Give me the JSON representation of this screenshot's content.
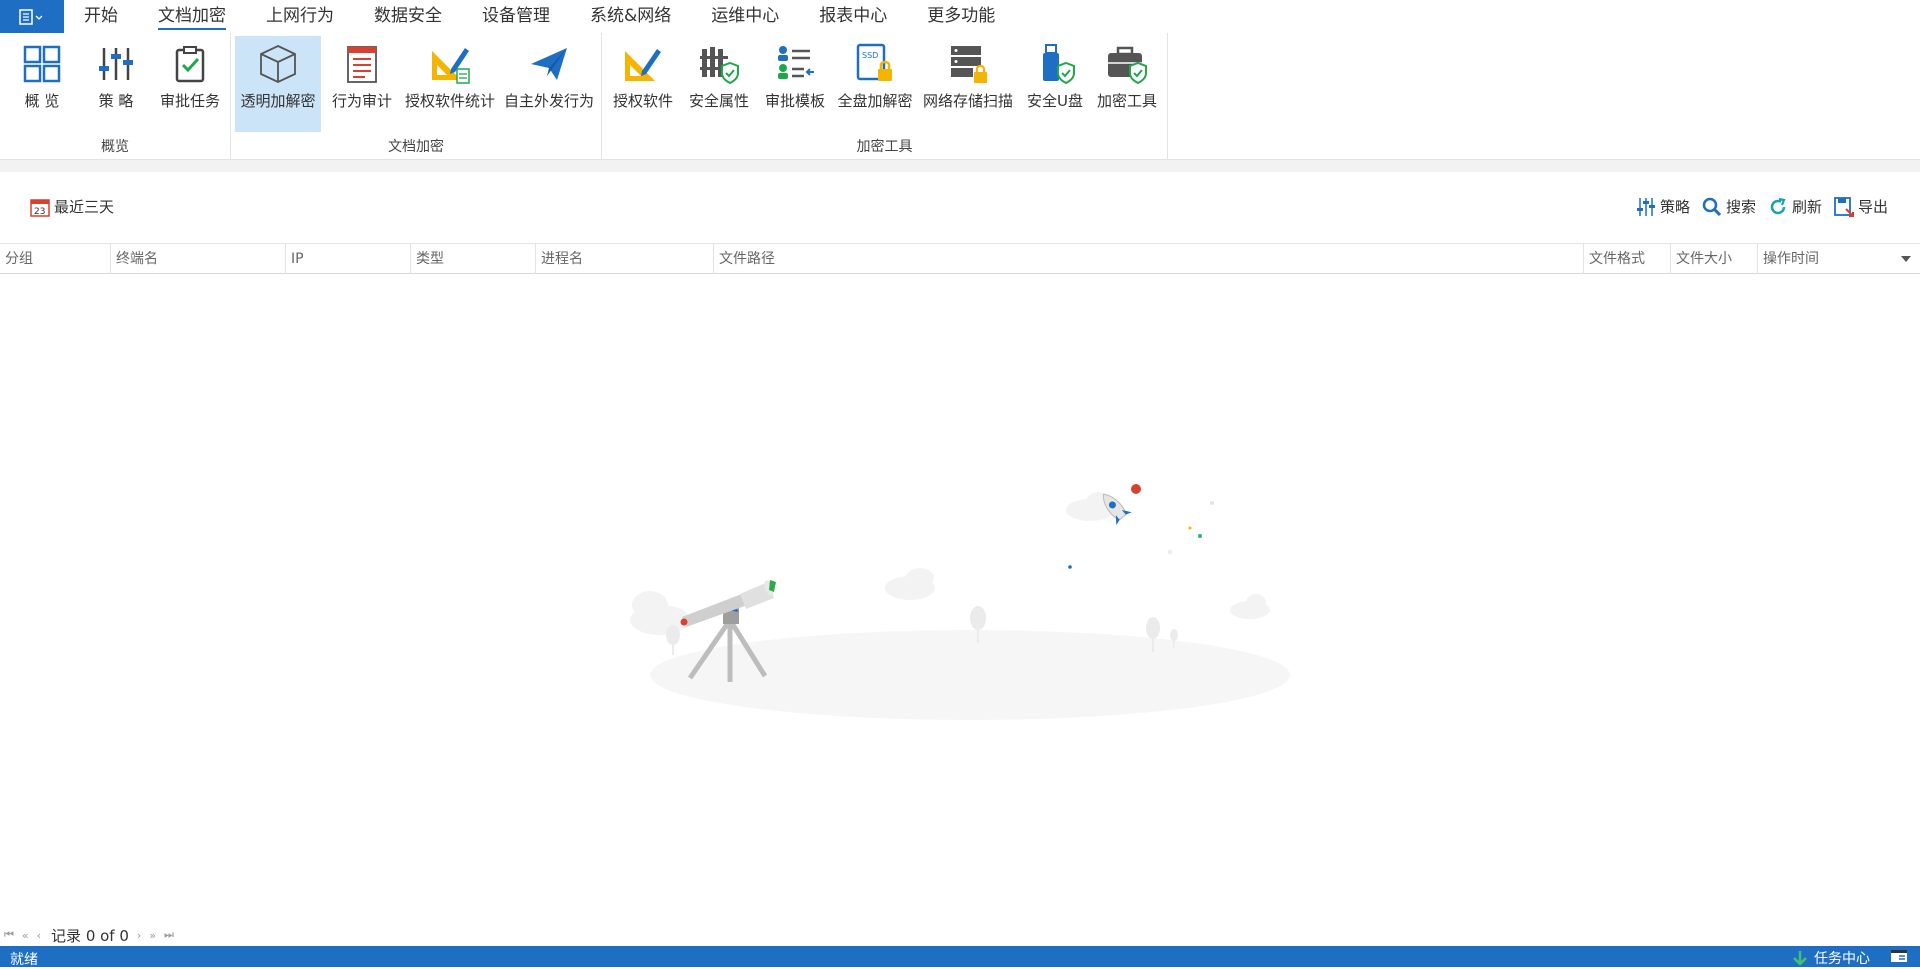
{
  "menu": {
    "tabs": [
      "开始",
      "文档加密",
      "上网行为",
      "数据安全",
      "设备管理",
      "系统&网络",
      "运维中心",
      "报表中心",
      "更多功能"
    ],
    "active_tab": "文档加密"
  },
  "ribbon": {
    "groups": [
      {
        "label": "概览",
        "buttons": [
          "概  览",
          "策  略",
          "审批任务"
        ]
      },
      {
        "label": "文档加密",
        "buttons": [
          "透明加解密",
          "行为审计",
          "授权软件统计",
          "自主外发行为"
        ]
      },
      {
        "label": "加密工具",
        "buttons": [
          "授权软件",
          "安全属性",
          "审批模板",
          "全盘加解密",
          "网络存储扫描",
          "安全U盘",
          "加密工具"
        ]
      }
    ],
    "selected_button": "透明加解密"
  },
  "toolbar": {
    "date_filter": "最近三天",
    "calendar_day": "23",
    "policy": "策略",
    "search": "搜索",
    "refresh": "刷新",
    "export": "导出"
  },
  "grid": {
    "columns": [
      "分组",
      "终端名",
      "IP",
      "类型",
      "进程名",
      "文件路径",
      "文件格式",
      "文件大小",
      "操作时间"
    ],
    "rows": []
  },
  "pager": {
    "record_text": "记录 0 of 0"
  },
  "status": {
    "text": "就绪",
    "task_center": "任务中心"
  },
  "colors": {
    "accent": "#1e6fc4",
    "selected_bg": "#cce4f7"
  }
}
